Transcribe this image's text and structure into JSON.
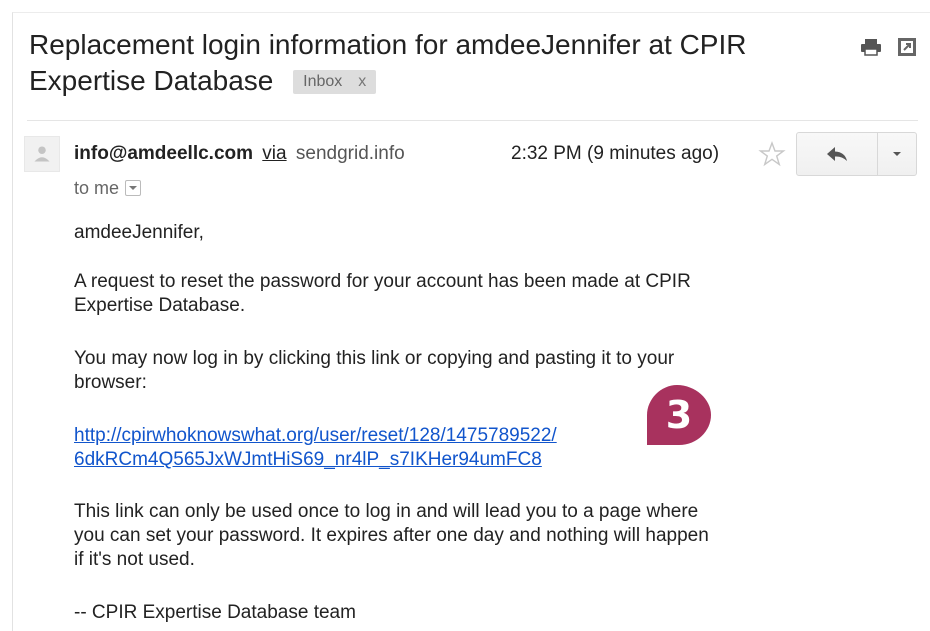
{
  "header": {
    "subject_line1": "Replacement login information for amdeeJennifer at CPIR",
    "subject_line2": "Expertise Database",
    "label": "Inbox",
    "label_remove": "x",
    "icons": [
      "print-icon",
      "new-window-icon"
    ]
  },
  "message": {
    "sender_email": "info@amdeellc.com",
    "via_text": "via",
    "via_domain": "sendgrid.info",
    "timestamp": "2:32 PM (9 minutes ago)",
    "to_text": "to me",
    "icons": [
      "avatar-placeholder",
      "star-icon",
      "reply-icon",
      "more-options-chevron-icon",
      "recipient-details-caret-icon"
    ]
  },
  "body": {
    "greeting": "amdeeJennifer,",
    "request_line1": "A request to reset the password for your account has been made at CPIR",
    "request_line2": "Expertise Database.",
    "login_line1": "You may now log in by clicking this link or copying and pasting it to your",
    "login_line2": "browser:",
    "link_line1": "http://cpirwhoknowswhat.org/user/reset/128/1475789522/",
    "link_line2": "6dkRCm4Q565JxWJmtHiS69_nr4lP_s7IKHer94umFC8",
    "expire_line1": "This link can only be used once to log in and will lead you to a page where",
    "expire_line2": "you can set your password. It expires after one day and nothing will happen",
    "expire_line3": "if it's not used.",
    "signature": "--  CPIR Expertise Database team"
  },
  "annotation": {
    "step_number": "3",
    "color": "#a8325e"
  },
  "colors": {
    "link": "#1155cc",
    "label_bg": "#dddddd",
    "badge": "#a8325e"
  }
}
